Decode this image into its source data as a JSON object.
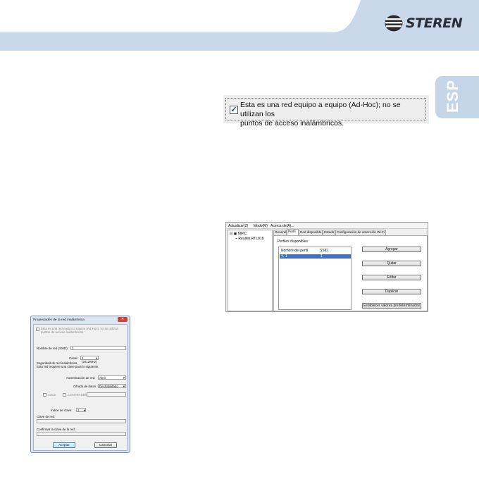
{
  "header": {
    "brand": "STEREN",
    "band_color": "#c9d8ea",
    "logo_icon": "steren-logo-icon"
  },
  "language_tab": {
    "label": "ESP",
    "color": "#c5d5e8"
  },
  "adhoc_option": {
    "checked": true,
    "line1": "Esta es una red equipo a equipo (Ad-Hoc); no se utilizan los",
    "line2": "puntos de acceso inalámbricos."
  },
  "profile_manager": {
    "menu": [
      "Actualizar(Z)",
      "Modo(M)",
      "Acerca de(A)..."
    ],
    "tree": {
      "root": "MIPC",
      "child": "Realtek RTL818"
    },
    "tabs": [
      "General",
      "Perfil",
      "Red disponible",
      "Estado",
      "Configuración de antención Wi-Fi"
    ],
    "active_tab": "Perfil",
    "section_label": "Perfiles disponibles",
    "list_headers": [
      "Nombre del perfil",
      "SSID"
    ],
    "selected_row": {
      "name": "1",
      "ssid": "1"
    },
    "buttons": [
      "Agregar",
      "Quitar",
      "Editar",
      "Duplicar",
      "Establecer valores predeterminados"
    ]
  },
  "wireless_dialog": {
    "title": "Propiedades de la red inalámbrica",
    "close_icon": "close-icon",
    "adhoc_line1": "Esta es una red equipo a equipo (Ad-Hoc); no se utilizan",
    "adhoc_line2": "puntos de acceso inalámbricos.",
    "ssid_label": "Nombre de red (SSID):",
    "ssid_value": "1",
    "channel_label": "Canal:",
    "channel_value": "1 (2412MHz)",
    "security_heading": "Seguridad de red inalámbrica",
    "security_desc": "Esta red requiere una clave para lo siguiente:",
    "auth_label": "Autenticación de red:",
    "auth_value": "Abrir",
    "encryption_label": "Cifrado de datos:",
    "encryption_value": "Deshabilitado",
    "ascii_label": "ASCII",
    "password_label": "CONTRASEÑA",
    "key_index_label": "Índice de clave:",
    "key_index_value": "1",
    "network_key_label": "Clave de red:",
    "confirm_key_label": "Confirmar la clave de la red:",
    "ok_label": "Aceptar",
    "cancel_label": "Cancelar"
  }
}
